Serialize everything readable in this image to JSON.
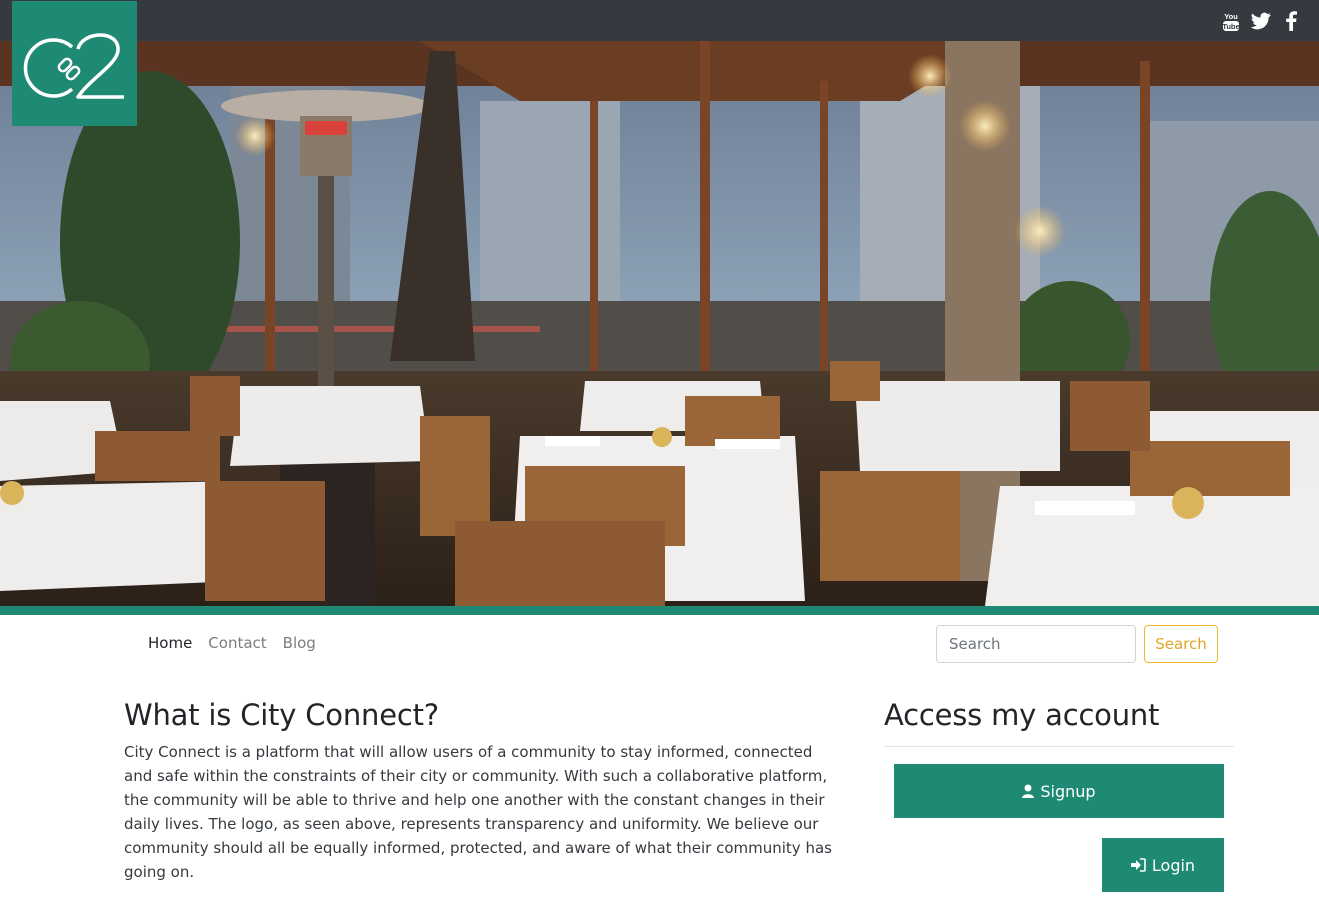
{
  "social": {
    "icons": [
      "youtube-icon",
      "twitter-icon",
      "facebook-icon"
    ],
    "youtube_label": "You Tube"
  },
  "logo": {
    "text": "c2"
  },
  "nav": {
    "items": [
      {
        "label": "Home",
        "active": true
      },
      {
        "label": "Contact",
        "active": false
      },
      {
        "label": "Blog",
        "active": false
      }
    ]
  },
  "search": {
    "placeholder": "Search",
    "button_label": "Search"
  },
  "about": {
    "title": "What is City Connect?",
    "body": "City Connect is a platform that will allow users of a community to stay informed, connected and safe within the constraints of their city or community. With such a collaborative platform, the community will be able to thrive and help one another with the constant changes in their daily lives. The logo, as seen above, represents transparency and uniformity. We believe our community should all be equally informed, protected, and aware of what their community has going on."
  },
  "account": {
    "title": "Access my account",
    "signup_label": "Signup",
    "login_label": "Login"
  },
  "colors": {
    "brand": "#1f8a74",
    "topbar": "#343a40",
    "search_accent": "#f0b82d"
  }
}
